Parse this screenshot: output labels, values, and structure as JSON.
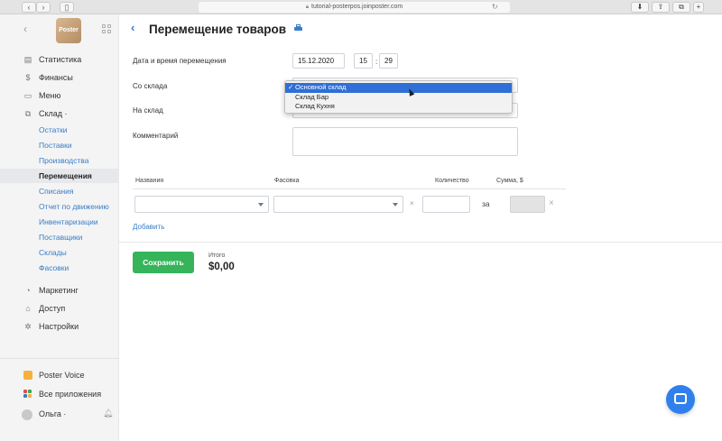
{
  "browser": {
    "url": "tutorial-posterpos.joinposter.com",
    "lock_icon": "lock-icon",
    "reload_icon": "reload-icon"
  },
  "sidebar": {
    "logo_text": "Poster",
    "nav": [
      {
        "icon": "chart-icon",
        "glyph": "▤",
        "label": "Статистика"
      },
      {
        "icon": "dollar-icon",
        "glyph": "$",
        "label": "Финансы"
      },
      {
        "icon": "menu-icon",
        "glyph": "▭",
        "label": "Меню"
      },
      {
        "icon": "box-icon",
        "glyph": "⧉",
        "label": "Склад ·"
      }
    ],
    "warehouse_sub": [
      {
        "label": "Остатки",
        "active": false
      },
      {
        "label": "Поставки",
        "active": false
      },
      {
        "label": "Производства",
        "active": false
      },
      {
        "label": "Перемещения",
        "active": true
      },
      {
        "label": "Списания",
        "active": false
      },
      {
        "label": "Отчет по движению",
        "active": false
      },
      {
        "label": "Инвентаризации",
        "active": false
      },
      {
        "label": "Поставщики",
        "active": false
      },
      {
        "label": "Склады",
        "active": false
      },
      {
        "label": "Фасовки",
        "active": false
      }
    ],
    "nav_bottom": [
      {
        "icon": "marketing-icon",
        "glyph": "◔",
        "label": "Маркетинг"
      },
      {
        "icon": "lock-icon",
        "glyph": "⌂",
        "label": "Доступ"
      },
      {
        "icon": "settings-icon",
        "glyph": "✲",
        "label": "Настройки"
      }
    ],
    "voice_label": "Poster Voice",
    "apps_label": "Все приложения",
    "user_name": "Ольга ·"
  },
  "page": {
    "title": "Перемещение товаров",
    "date_label": "Дата и время перемещения",
    "date_value": "15.12.2020",
    "hour_value": "15",
    "time_sep": ":",
    "minute_value": "29",
    "from_label": "Со склада",
    "to_label": "На склад",
    "comment_label": "Комментарий",
    "dropdown_options": [
      {
        "label": "Основной склад",
        "selected": true
      },
      {
        "label": "Склад Бар",
        "selected": false
      },
      {
        "label": "Склад Кухня",
        "selected": false
      }
    ],
    "check_mark": "✓",
    "columns": {
      "name": "Названия",
      "pack": "Фасовка",
      "qty": "Количество",
      "sum": "Сумма, $"
    },
    "multiply": "×",
    "za": "за",
    "remove": "×",
    "add_link": "Добавить",
    "save_button": "Сохранить",
    "total_label": "Итого",
    "total_value": "$0,00"
  },
  "colors": {
    "accent": "#3a7cc8",
    "save_green": "#35b45a",
    "selected_option": "#2f6fd6",
    "chat_blue": "#2f80ed"
  }
}
